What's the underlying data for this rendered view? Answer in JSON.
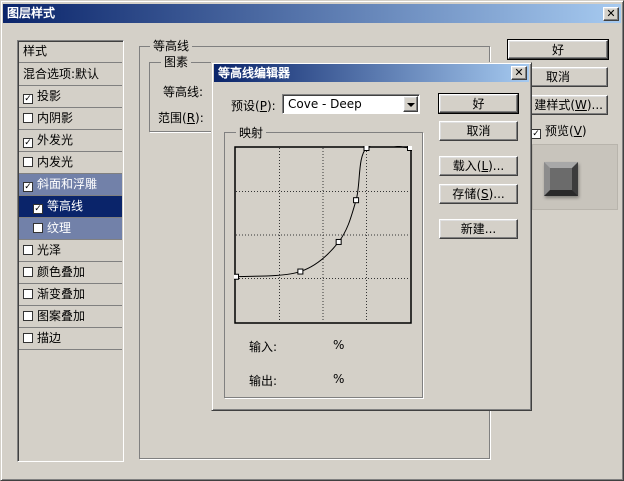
{
  "main_window": {
    "title": "图层样式",
    "close_glyph": "✕"
  },
  "sidebar": {
    "items": [
      {
        "label": "样式",
        "checkbox": false,
        "checked": false,
        "state": "normal"
      },
      {
        "label": "混合选项:默认",
        "checkbox": false,
        "checked": false,
        "state": "normal"
      },
      {
        "label": "投影",
        "checkbox": true,
        "checked": true,
        "state": "normal"
      },
      {
        "label": "内阴影",
        "checkbox": true,
        "checked": false,
        "state": "normal"
      },
      {
        "label": "外发光",
        "checkbox": true,
        "checked": true,
        "state": "normal"
      },
      {
        "label": "内发光",
        "checkbox": true,
        "checked": false,
        "state": "normal"
      },
      {
        "label": "斜面和浮雕",
        "checkbox": true,
        "checked": true,
        "state": "selected"
      },
      {
        "label": "等高线",
        "checkbox": true,
        "checked": true,
        "state": "active"
      },
      {
        "label": "纹理",
        "checkbox": true,
        "checked": false,
        "state": "selected"
      },
      {
        "label": "光泽",
        "checkbox": true,
        "checked": false,
        "state": "normal"
      },
      {
        "label": "颜色叠加",
        "checkbox": true,
        "checked": false,
        "state": "normal"
      },
      {
        "label": "渐变叠加",
        "checkbox": true,
        "checked": false,
        "state": "normal"
      },
      {
        "label": "图案叠加",
        "checkbox": true,
        "checked": false,
        "state": "normal"
      },
      {
        "label": "描边",
        "checkbox": true,
        "checked": false,
        "state": "normal"
      }
    ]
  },
  "contour_panel": {
    "group_title": "等高线",
    "sub_group_title": "图素",
    "contour_label": "等高线:",
    "range_label": "范围(",
    "range_key": "R",
    "range_suffix": "):"
  },
  "right_buttons": {
    "ok": "好",
    "cancel": "取消",
    "new_style_prefix": "建样式(",
    "new_style_key": "W",
    "new_style_suffix": ")...",
    "preview_label_prefix": "预览(",
    "preview_key": "V",
    "preview_label_suffix": ")",
    "preview_checked": true,
    "check_glyph": "✓"
  },
  "contour_editor": {
    "title": "等高线编辑器",
    "close_glyph": "✕",
    "preset_label_prefix": "预设(",
    "preset_key": "P",
    "preset_label_suffix": "):",
    "preset_value": "Cove - Deep",
    "mapping_group": "映射",
    "input_label": "输入:",
    "input_unit": "%",
    "output_label": "输出:",
    "output_unit": "%",
    "buttons": {
      "ok": "好",
      "cancel": "取消",
      "load_prefix": "载入(",
      "load_key": "L",
      "load_suffix": ")...",
      "save_prefix": "存储(",
      "save_key": "S",
      "save_suffix": ")...",
      "new": "新建..."
    },
    "curve_points": [
      {
        "input": 0,
        "output": 26
      },
      {
        "input": 37,
        "output": 29
      },
      {
        "input": 59,
        "output": 46
      },
      {
        "input": 69,
        "output": 70
      },
      {
        "input": 75,
        "output": 100
      },
      {
        "input": 100,
        "output": 100
      }
    ],
    "colors": {
      "grid": "#333333",
      "curve": "#000000",
      "graph_bg": "#d4d0c8"
    }
  }
}
